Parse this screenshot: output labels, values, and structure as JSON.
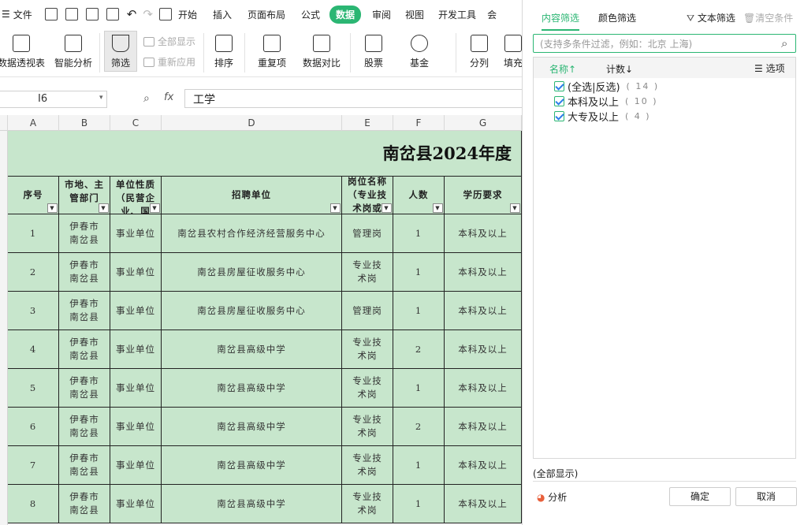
{
  "menu": {
    "file": "文件",
    "items": [
      "开始",
      "插入",
      "页面布局",
      "公式",
      "数据",
      "审阅",
      "视图",
      "开发工具",
      "会"
    ],
    "active": "数据"
  },
  "ribbon": {
    "pivot": "数据透视表",
    "smart": "智能分析",
    "filter": "筛选",
    "show_all": "全部显示",
    "reapply": "重新应用",
    "sort": "排序",
    "dup": "重复项",
    "compare": "数据对比",
    "stock": "股票",
    "fund": "基金",
    "split": "分列",
    "fill": "填充"
  },
  "formula_bar": {
    "cell_ref": "I6",
    "fx": "fx",
    "value": "工学"
  },
  "columns": [
    "A",
    "B",
    "C",
    "D",
    "E",
    "F",
    "G"
  ],
  "sheet": {
    "title": "南岔县2024年度",
    "headers": [
      "序号",
      "市地、主管部门",
      "单位性质（民营企业、国",
      "招聘单位",
      "岗位名称（专业技术岗或",
      "人数",
      "学历要求"
    ],
    "rows": [
      [
        "1",
        "伊春市南岔县",
        "事业单位",
        "南岔县农村合作经济经营服务中心",
        "管理岗",
        "1",
        "本科及以上"
      ],
      [
        "2",
        "伊春市南岔县",
        "事业单位",
        "南岔县房屋征收服务中心",
        "专业技术岗",
        "1",
        "本科及以上"
      ],
      [
        "3",
        "伊春市南岔县",
        "事业单位",
        "南岔县房屋征收服务中心",
        "管理岗",
        "1",
        "本科及以上"
      ],
      [
        "4",
        "伊春市南岔县",
        "事业单位",
        "南岔县高级中学",
        "专业技术岗",
        "2",
        "本科及以上"
      ],
      [
        "5",
        "伊春市南岔县",
        "事业单位",
        "南岔县高级中学",
        "专业技术岗",
        "1",
        "本科及以上"
      ],
      [
        "6",
        "伊春市南岔县",
        "事业单位",
        "南岔县高级中学",
        "专业技术岗",
        "2",
        "本科及以上"
      ],
      [
        "7",
        "伊春市南岔县",
        "事业单位",
        "南岔县高级中学",
        "专业技术岗",
        "1",
        "本科及以上"
      ],
      [
        "8",
        "伊春市南岔县",
        "事业单位",
        "南岔县高级中学",
        "专业技术岗",
        "1",
        "本科及以上"
      ]
    ]
  },
  "panel": {
    "tab_content": "内容筛选",
    "tab_color": "颜色筛选",
    "text_filter": "文本筛选",
    "clear": "清空条件",
    "search_placeholder": "(支持多条件过滤，例如：北京 上海)",
    "col_name": "名称↑",
    "col_count": "计数↓",
    "options": "选项",
    "items": [
      {
        "label": "(全选|反选)",
        "count": "( 14 )"
      },
      {
        "label": "本科及以上",
        "count": "( 10 )"
      },
      {
        "label": "大专及以上",
        "count": "( 4 )"
      }
    ],
    "show_all": "(全部显示)",
    "analyze": "分析",
    "ok": "确定",
    "cancel": "取消"
  },
  "colors": {
    "accent": "#2bb673",
    "cell_bg": "#c7e6cc"
  }
}
